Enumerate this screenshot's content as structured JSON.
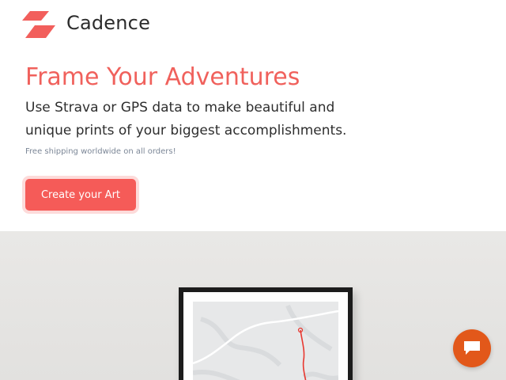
{
  "brand": {
    "name": "Cadence",
    "logo_icon": "cadence-logo-icon",
    "accent_color": "#f0615c"
  },
  "hero": {
    "headline": "Frame Your Adventures",
    "subheadline": "Use Strava or GPS data to make beautiful and unique prints of your biggest accomplishments.",
    "shipping_note": "Free shipping worldwide on all orders!",
    "cta_label": "Create your Art",
    "cta_color": "#f55b58"
  },
  "showcase": {
    "image": "framed-route-map-print"
  },
  "chat": {
    "icon": "chat-bubble-icon",
    "color": "#e2581a"
  }
}
